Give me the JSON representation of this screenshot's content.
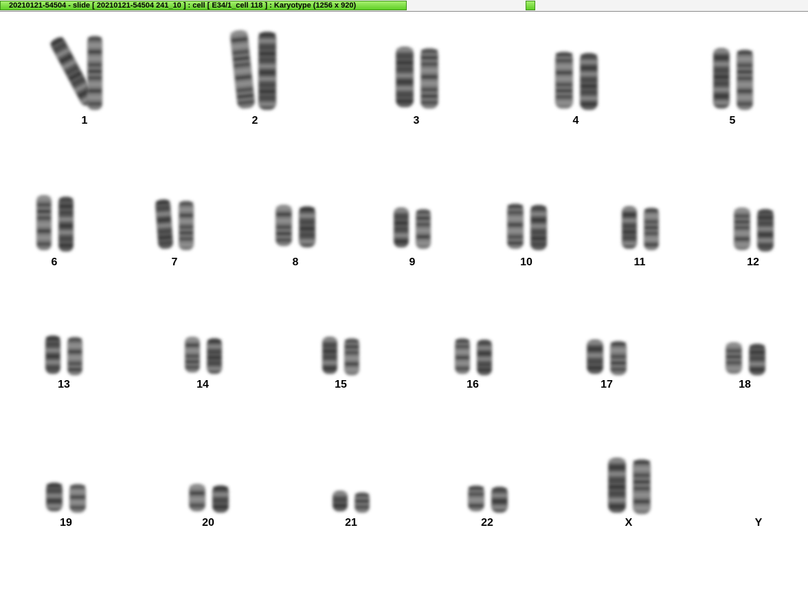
{
  "window": {
    "title": "20210121-54504 - slide [ 20210121-54504 241_10 ] : cell [ E34/1_cell 118 ] : Karyotype  (1256 x 920)"
  },
  "karyotype": {
    "chromosomes": [
      {
        "label": "1"
      },
      {
        "label": "2"
      },
      {
        "label": "3"
      },
      {
        "label": "4"
      },
      {
        "label": "5"
      },
      {
        "label": "6"
      },
      {
        "label": "7"
      },
      {
        "label": "8"
      },
      {
        "label": "9"
      },
      {
        "label": "10"
      },
      {
        "label": "11"
      },
      {
        "label": "12"
      },
      {
        "label": "13"
      },
      {
        "label": "14"
      },
      {
        "label": "15"
      },
      {
        "label": "16"
      },
      {
        "label": "17"
      },
      {
        "label": "18"
      },
      {
        "label": "19"
      },
      {
        "label": "20"
      },
      {
        "label": "21"
      },
      {
        "label": "22"
      },
      {
        "label": "X"
      },
      {
        "label": "Y"
      }
    ]
  },
  "colors": {
    "title_tab": "#6fd836",
    "chromatin_dark": "#2a2a2a",
    "chromatin_light": "#8a8a8a"
  }
}
